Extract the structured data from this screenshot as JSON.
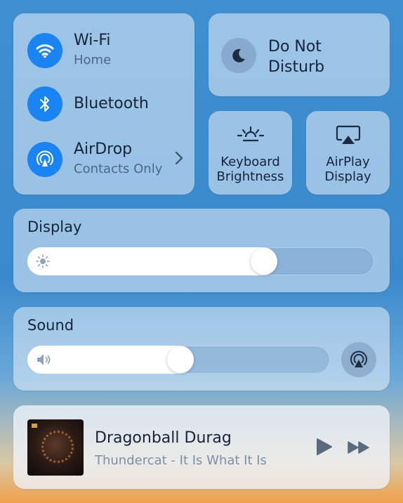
{
  "network": {
    "wifi": {
      "label": "Wi-Fi",
      "status": "Home"
    },
    "bluetooth": {
      "label": "Bluetooth"
    },
    "airdrop": {
      "label": "AirDrop",
      "status": "Contacts Only"
    }
  },
  "do_not_disturb": {
    "label_line1": "Do Not",
    "label_line2": "Disturb"
  },
  "keyboard_brightness": {
    "line1": "Keyboard",
    "line2": "Brightness"
  },
  "airplay_display": {
    "line1": "AirPlay",
    "line2": "Display"
  },
  "display": {
    "label": "Display",
    "level": 0.72
  },
  "sound": {
    "label": "Sound",
    "level": 0.55
  },
  "now_playing": {
    "title": "Dragonball Durag",
    "subtitle": "Thundercat - It Is What It Is"
  },
  "colors": {
    "accent": "#1a84f2",
    "text": "#16233a",
    "subtext": "#4d6886"
  },
  "icons": [
    "wifi-icon",
    "bluetooth-icon",
    "airdrop-icon",
    "chevron-right-icon",
    "moon-icon",
    "keyboard-brightness-icon",
    "airplay-icon",
    "sun-icon",
    "speaker-icon",
    "airplay-audio-icon",
    "play-icon",
    "fast-forward-icon"
  ]
}
